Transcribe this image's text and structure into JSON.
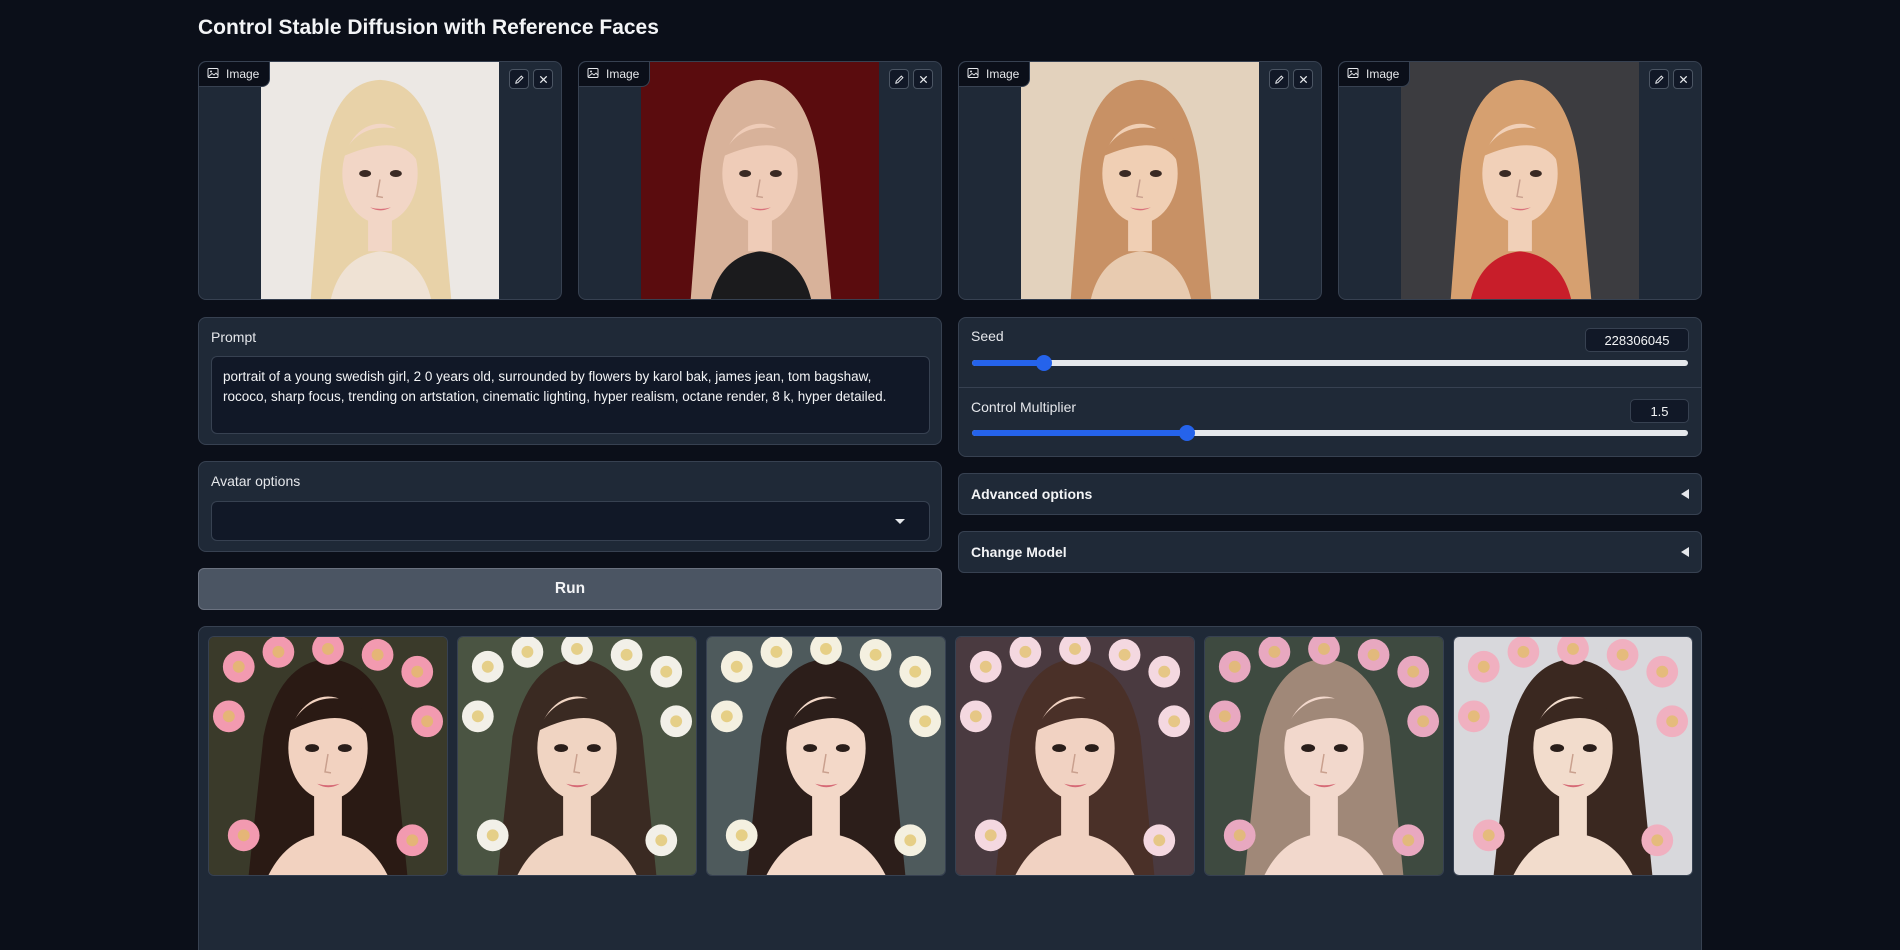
{
  "page": {
    "title": "Control Stable Diffusion with Reference Faces"
  },
  "image_inputs": [
    {
      "label": "Image",
      "bg": "#ece8e4",
      "hair": "#e8d2a8",
      "skin": "#f2d6c6",
      "shirt": "#efe2d4"
    },
    {
      "label": "Image",
      "bg": "#5a0c0e",
      "hair": "#d8b29a",
      "skin": "#efccb8",
      "shirt": "#1b1b1d"
    },
    {
      "label": "Image",
      "bg": "#e3d2bd",
      "hair": "#c89165",
      "skin": "#f0cfb4",
      "shirt": "#e8cbb0"
    },
    {
      "label": "Image",
      "bg": "#3c3c40",
      "hair": "#d6a070",
      "skin": "#f1d0b8",
      "shirt": "#c81e2a"
    }
  ],
  "prompt": {
    "label": "Prompt",
    "value": "portrait of a young swedish girl, 2 0 years old, surrounded by flowers by karol bak, james jean, tom bagshaw, rococo, sharp focus, trending on artstation, cinematic lighting, hyper realism, octane render, 8 k, hyper detailed."
  },
  "avatar_options": {
    "label": "Avatar options",
    "value": ""
  },
  "run_button": {
    "label": "Run"
  },
  "seed": {
    "label": "Seed",
    "value": "228306045",
    "fraction": 0.1
  },
  "control_multiplier": {
    "label": "Control Multiplier",
    "value": "1.5",
    "fraction": 0.3
  },
  "advanced_options": {
    "label": "Advanced options"
  },
  "change_model": {
    "label": "Change Model"
  },
  "gallery": [
    {
      "bg": "#3a3a2a",
      "hair": "#2a1a14",
      "skin": "#f2d2c0",
      "flower": "#f29ab0"
    },
    {
      "bg": "#4a5442",
      "hair": "#3a2a22",
      "skin": "#f0d4c2",
      "flower": "#f2f0e8"
    },
    {
      "bg": "#4e5a5c",
      "hair": "#2c1e1a",
      "skin": "#f3d8c8",
      "flower": "#f4f0e0"
    },
    {
      "bg": "#4a3a40",
      "hair": "#4a3028",
      "skin": "#f1d2c2",
      "flower": "#f4d8e0"
    },
    {
      "bg": "#3e4a40",
      "hair": "#a08878",
      "skin": "#f2d8cc",
      "flower": "#e8a8c0"
    },
    {
      "bg": "#d8d8dc",
      "hair": "#3a2820",
      "skin": "#f2dccc",
      "flower": "#f0b0c0"
    }
  ]
}
